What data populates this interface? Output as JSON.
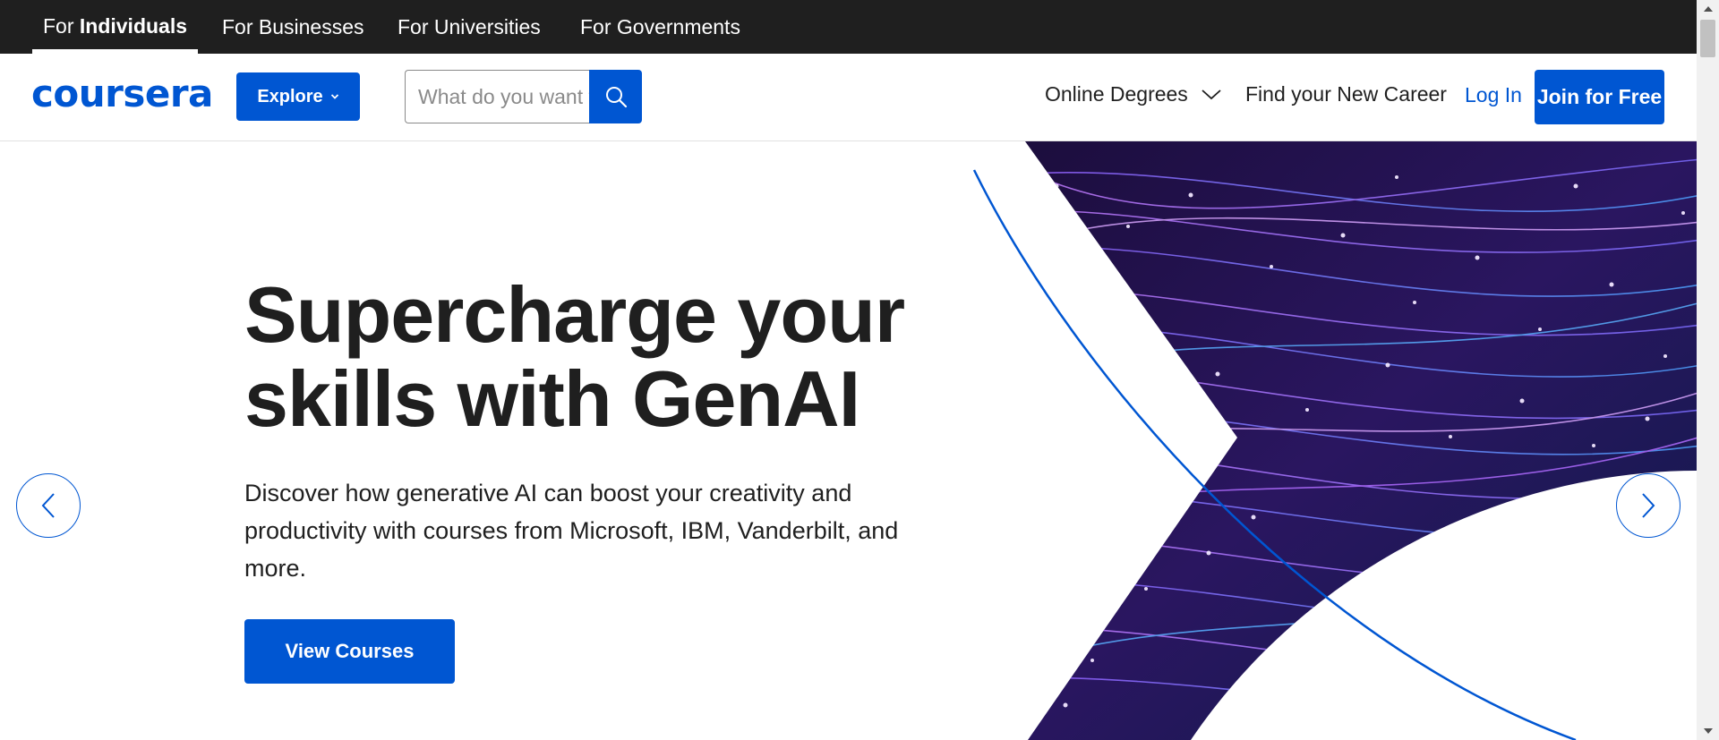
{
  "audience_tabs": [
    {
      "prefix": "For ",
      "label": "Individuals"
    },
    {
      "label": "For Businesses"
    },
    {
      "label": "For Universities"
    },
    {
      "label": "For Governments"
    }
  ],
  "header": {
    "logo_text": "coursera",
    "explore_label": "Explore",
    "search_placeholder": "What do you want to learn?",
    "nav_degrees": "Online Degrees",
    "nav_career": "Find your New Career",
    "login_label": "Log In",
    "join_label": "Join for Free"
  },
  "hero": {
    "title_line1": "Supercharge your",
    "title_line2": "skills with GenAI",
    "subtitle": "Discover how generative AI can boost your creativity and productivity with courses from Microsoft, IBM, Vanderbilt, and more.",
    "cta_label": "View Courses"
  },
  "icons": {
    "search": "search-icon",
    "dropdown": "chevron-down-icon",
    "prev": "chevron-left-icon",
    "next": "chevron-right-icon"
  },
  "colors": {
    "brand": "#0056d2",
    "top_bar": "#1f1f1f",
    "text": "#1f1f1f"
  }
}
